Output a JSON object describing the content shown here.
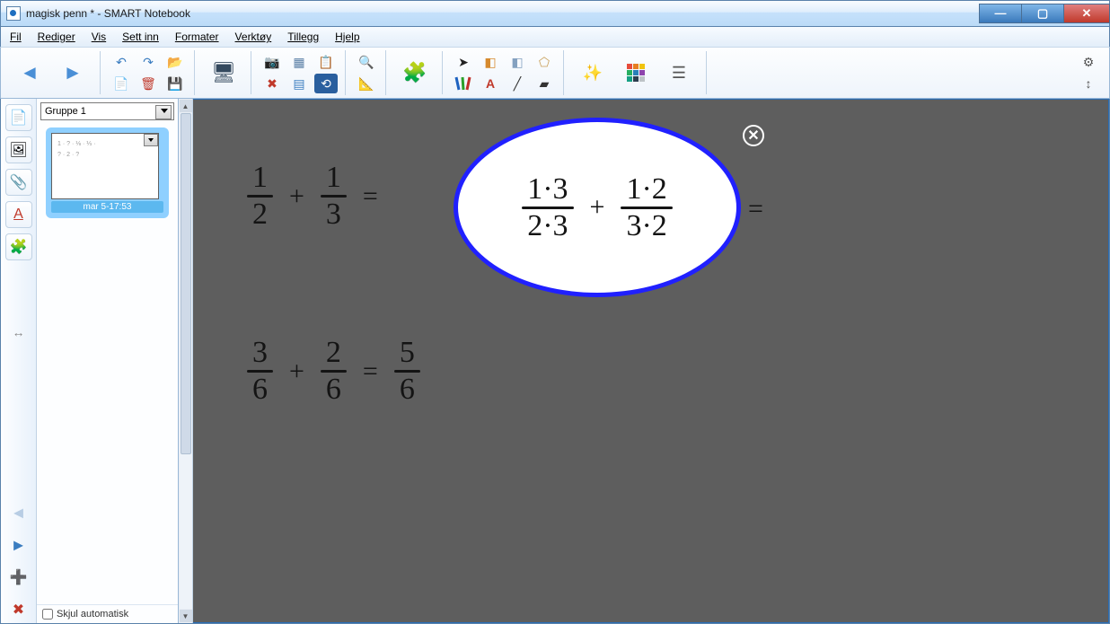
{
  "window": {
    "title": "magisk penn * - SMART Notebook"
  },
  "menu": {
    "file": "Fil",
    "edit": "Rediger",
    "view": "Vis",
    "insert": "Sett inn",
    "format": "Formater",
    "tools": "Verktøy",
    "addons": "Tillegg",
    "help": "Hjelp"
  },
  "toolbar": {
    "prev": "◄",
    "next": "►",
    "undo": "↶",
    "redo": "↷",
    "open": "📂",
    "newpage": "📄",
    "delpage": "🗑",
    "save": "💾",
    "screenshade": "🖥",
    "doccam": "📷",
    "table": "▦",
    "response": "📋",
    "capture": "🔍",
    "delete": "✖",
    "grid": "▤",
    "reset": "⟲",
    "measure": "📐",
    "addon": "🧩",
    "select": "➤",
    "shape": "◧",
    "eraser": "◧",
    "regpoly": "⬠",
    "pen": "✎",
    "text": "A",
    "line": "╱",
    "fill": "▰",
    "magic": "✨",
    "color": "▦",
    "props": "☰",
    "settings": "⚙",
    "move": "↕"
  },
  "sidebar": {
    "group": "Gruppe 1",
    "thumb": {
      "timestamp": "mar 5-17:53",
      "mini1": "1 · ? · ⅛ · ⅓ ·",
      "mini2": "? · 2 · ?"
    },
    "hide": "Skjul automatisk",
    "tabs": {
      "pages": "📄",
      "gallery": "🖼",
      "attach": "📎",
      "props": "A",
      "addons": "🧩",
      "prev": "◄",
      "next": "►",
      "add": "➕",
      "del": "✖",
      "resize": "↔"
    }
  },
  "canvas": {
    "close": "✕",
    "eq1": {
      "f1": {
        "n": "1",
        "d": "2"
      },
      "plus1": "+",
      "f2": {
        "n": "1",
        "d": "3"
      },
      "eq1": "=",
      "f3": {
        "n": "1·3",
        "d": "2·3"
      },
      "plus2": "+",
      "f4": {
        "n": "1·2",
        "d": "3·2"
      },
      "eq2": "="
    },
    "eq2": {
      "f1": {
        "n": "3",
        "d": "6"
      },
      "plus": "+",
      "f2": {
        "n": "2",
        "d": "6"
      },
      "eq": "=",
      "f3": {
        "n": "5",
        "d": "6"
      }
    }
  }
}
